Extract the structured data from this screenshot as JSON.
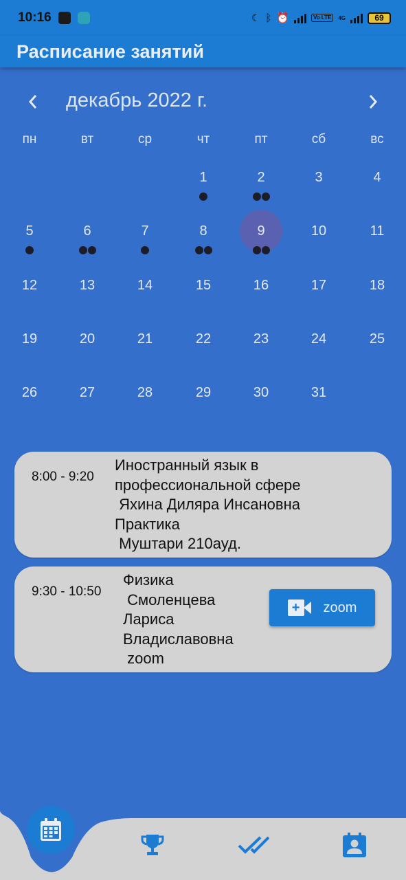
{
  "status_bar": {
    "time": "10:16",
    "battery": "69",
    "network": "4G",
    "volte": "Vo LTE"
  },
  "app_bar": {
    "title": "Расписание занятий"
  },
  "calendar": {
    "month_title": "декабрь 2022 г.",
    "prev_icon": "chevron-left-icon",
    "next_icon": "chevron-right-icon",
    "weekdays": [
      "пн",
      "вт",
      "ср",
      "чт",
      "пт",
      "сб",
      "вс"
    ],
    "days": [
      {
        "label": "1",
        "dots": 1
      },
      {
        "label": "2",
        "dots": 2
      },
      {
        "label": "3",
        "dots": 0
      },
      {
        "label": "4",
        "dots": 0
      },
      {
        "label": "5",
        "dots": 1
      },
      {
        "label": "6",
        "dots": 2
      },
      {
        "label": "7",
        "dots": 1
      },
      {
        "label": "8",
        "dots": 2
      },
      {
        "label": "9",
        "dots": 2,
        "selected": true
      },
      {
        "label": "10",
        "dots": 0
      },
      {
        "label": "11",
        "dots": 0
      },
      {
        "label": "12",
        "dots": 0
      },
      {
        "label": "13",
        "dots": 0
      },
      {
        "label": "14",
        "dots": 0
      },
      {
        "label": "15",
        "dots": 0
      },
      {
        "label": "16",
        "dots": 0
      },
      {
        "label": "17",
        "dots": 0
      },
      {
        "label": "18",
        "dots": 0
      },
      {
        "label": "19",
        "dots": 0
      },
      {
        "label": "20",
        "dots": 0
      },
      {
        "label": "21",
        "dots": 0
      },
      {
        "label": "22",
        "dots": 0
      },
      {
        "label": "23",
        "dots": 0
      },
      {
        "label": "24",
        "dots": 0
      },
      {
        "label": "25",
        "dots": 0
      },
      {
        "label": "26",
        "dots": 0
      },
      {
        "label": "27",
        "dots": 0
      },
      {
        "label": "28",
        "dots": 0
      },
      {
        "label": "29",
        "dots": 0
      },
      {
        "label": "30",
        "dots": 0
      },
      {
        "label": "31",
        "dots": 0
      }
    ],
    "first_weekday_index": 3
  },
  "lessons": [
    {
      "time": "8:00 - 9:20",
      "lines": [
        "Иностранный язык в",
        "профессиональной сфере",
        " Яхина Диляра Инсановна",
        "Практика",
        " Муштари 210ауд."
      ]
    },
    {
      "time": "9:30 - 10:50",
      "lines": [
        "Физика",
        " Смоленцева",
        "Лариса",
        "Владиславовна",
        " zoom"
      ],
      "button_label": "zoom",
      "button_icon": "video-add-icon"
    }
  ],
  "bottom_nav": {
    "items": [
      {
        "name": "calendar-icon",
        "active": true
      },
      {
        "name": "trophy-icon",
        "active": false
      },
      {
        "name": "done-all-icon",
        "active": false
      },
      {
        "name": "profile-icon",
        "active": false
      }
    ]
  },
  "colors": {
    "background": "#356fcc",
    "app_bar": "#1c7bd2",
    "card": "#d3d3d3",
    "selected_day": "#5961b0",
    "event_dot": "#1d1d2a"
  }
}
